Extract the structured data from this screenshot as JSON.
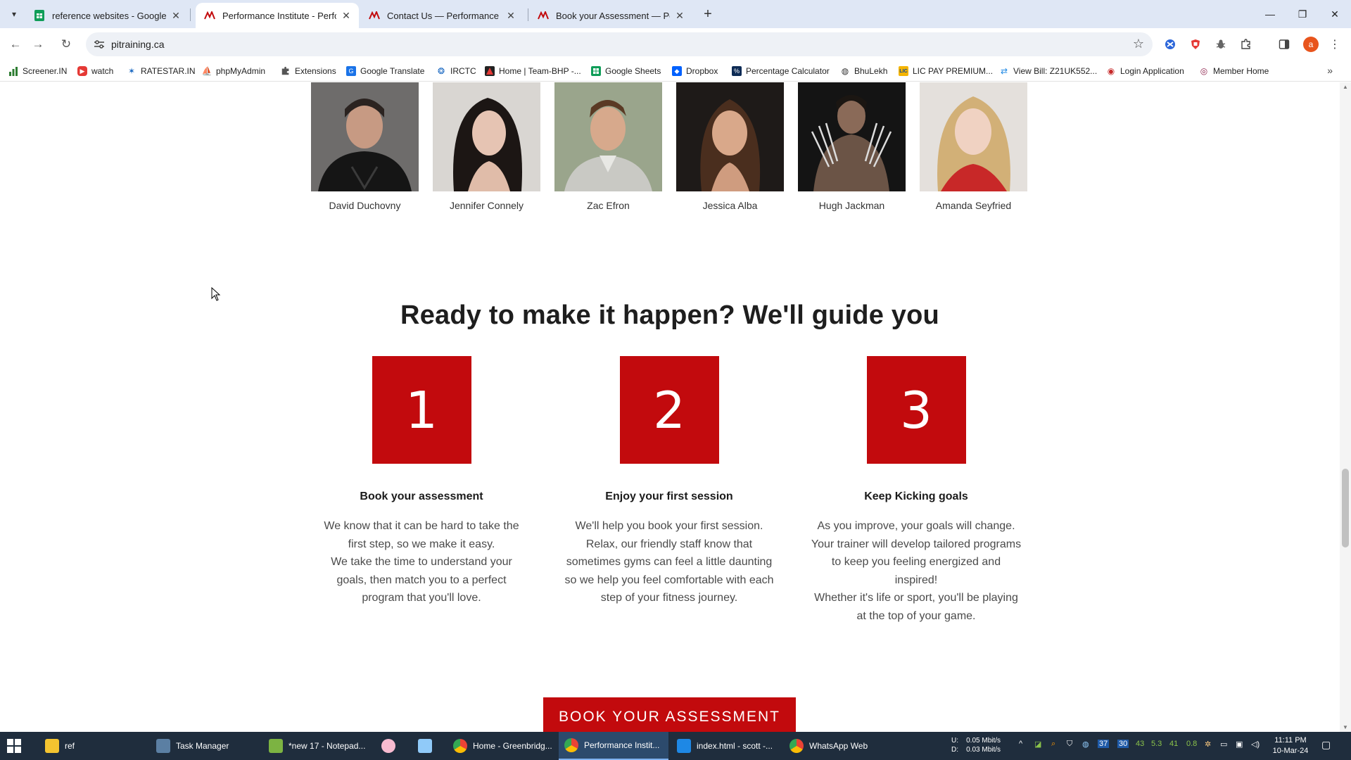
{
  "browser": {
    "tabs": [
      {
        "title": "reference websites - Google Sh",
        "active": false,
        "favicon": "google-sheets-icon"
      },
      {
        "title": "Performance Institute - Perform",
        "active": true,
        "favicon": "performance-institute-icon"
      },
      {
        "title": "Contact Us — Performance Inst",
        "active": false,
        "favicon": "performance-institute-icon"
      },
      {
        "title": "Book your Assessment — Perfo",
        "active": false,
        "favicon": "performance-institute-icon"
      }
    ],
    "url": "pitraining.ca",
    "profile_initial": "a",
    "bookmarks": [
      {
        "label": "Screener.IN",
        "icon": "bar-chart-icon",
        "color": "#2e7d32"
      },
      {
        "label": "watch",
        "icon": "youtube-icon",
        "color": "#e53935"
      },
      {
        "label": "RATESTAR.IN",
        "icon": "star-burst-icon",
        "color": "#1565c0"
      },
      {
        "label": "phpMyAdmin",
        "icon": "boat-icon",
        "color": "#6d4c41"
      },
      {
        "label": "Extensions",
        "icon": "puzzle-icon",
        "color": "#555555"
      },
      {
        "label": "Google Translate",
        "icon": "translate-icon",
        "color": "#1a73e8"
      },
      {
        "label": "IRCTC",
        "icon": "train-icon",
        "color": "#1565c0"
      },
      {
        "label": "Home | Team-BHP -...",
        "icon": "team-bhp-icon",
        "color": "#222222"
      },
      {
        "label": "Google Sheets",
        "icon": "google-sheets-icon",
        "color": "#0f9d58"
      },
      {
        "label": "Dropbox",
        "icon": "dropbox-icon",
        "color": "#0061fe"
      },
      {
        "label": "Percentage Calculator",
        "icon": "calculator-icon",
        "color": "#0d2b55"
      },
      {
        "label": "BhuLekh",
        "icon": "globe-icon",
        "color": "#333333"
      },
      {
        "label": "LIC PAY PREMIUM...",
        "icon": "lic-icon",
        "color": "#f4b400"
      },
      {
        "label": "View Bill: Z21UK552...",
        "icon": "bill-icon",
        "color": "#1e88e5"
      },
      {
        "label": "Login Application",
        "icon": "login-icon",
        "color": "#c62828"
      },
      {
        "label": "Member Home",
        "icon": "member-icon",
        "color": "#8e244d"
      }
    ]
  },
  "page": {
    "celebrities": [
      {
        "name": "David Duchovny"
      },
      {
        "name": "Jennifer Connely"
      },
      {
        "name": "Zac Efron"
      },
      {
        "name": "Jessica Alba"
      },
      {
        "name": "Hugh Jackman"
      },
      {
        "name": "Amanda Seyfried"
      }
    ],
    "headline": "Ready to make it happen? We'll guide you",
    "steps": [
      {
        "number": "1",
        "title": "Book your assessment",
        "lines": [
          "We know that it can be hard to take the",
          "first step, so we make it easy.",
          "We take the time to understand your",
          "goals, then match you to a perfect",
          "program that you'll love."
        ]
      },
      {
        "number": "2",
        "title": "Enjoy your first session",
        "lines": [
          "We'll help you book your first session.",
          "Relax, our friendly staff know that",
          "sometimes gyms can feel a little daunting",
          "so we help you feel comfortable with each",
          "step of your fitness journey."
        ]
      },
      {
        "number": "3",
        "title": "Keep Kicking goals",
        "lines": [
          "As you improve, your goals will change.",
          "Your trainer will develop tailored programs",
          "to keep you feeling energized and",
          "inspired!",
          "Whether it's life or sport, you'll be playing",
          "at the top of your game."
        ]
      }
    ],
    "cta_label": "BOOK YOUR ASSESSMENT",
    "accent_color": "#c20a0d"
  },
  "taskbar": {
    "items": [
      {
        "label": "ref",
        "icon": "folder-icon"
      },
      {
        "label": "Task Manager",
        "icon": "task-manager-icon"
      },
      {
        "label": "*new 17 - Notepad...",
        "icon": "notepad-plus-icon"
      },
      {
        "label": "",
        "icon": "pig-app-icon"
      },
      {
        "label": "",
        "icon": "notepad-icon"
      },
      {
        "label": "Home - Greenbridg...",
        "icon": "chrome-icon"
      },
      {
        "label": "Performance Instit...",
        "icon": "chrome-icon"
      },
      {
        "label": "index.html - scott -...",
        "icon": "vscode-icon"
      },
      {
        "label": "WhatsApp Web",
        "icon": "chrome-icon"
      }
    ],
    "network": {
      "up_label": "U:",
      "up": "0.05 Mbit/s",
      "down_label": "D:",
      "down": "0.03 Mbit/s"
    },
    "tray_numbers": [
      "37",
      "30",
      "43",
      "5.3",
      "41",
      "0.8"
    ],
    "time": "11:11 PM",
    "date": "10-Mar-24"
  }
}
